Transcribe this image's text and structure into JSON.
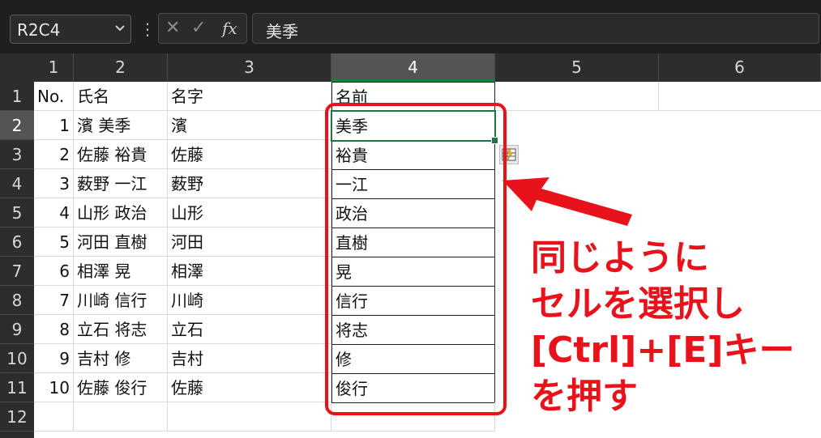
{
  "formula_bar": {
    "name_box": "R2C4",
    "dropdown_icon": "chevron-down-icon",
    "separator": "⋮",
    "cancel_icon": "✕",
    "enter_icon": "✓",
    "fx_label": "fx",
    "value": "美季"
  },
  "columns": [
    "1",
    "2",
    "3",
    "4",
    "5",
    "6"
  ],
  "rows": [
    "1",
    "2",
    "3",
    "4",
    "5",
    "6",
    "7",
    "8",
    "9",
    "10",
    "11",
    "12"
  ],
  "sheet": {
    "headers": [
      "No.",
      "氏名",
      "名字",
      "名前"
    ],
    "data": [
      [
        "1",
        "濱 美季",
        "濱",
        "美季"
      ],
      [
        "2",
        "佐藤 裕貴",
        "佐藤",
        "裕貴"
      ],
      [
        "3",
        "薮野 一江",
        "薮野",
        "一江"
      ],
      [
        "4",
        "山形 政治",
        "山形",
        "政治"
      ],
      [
        "5",
        "河田 直樹",
        "河田",
        "直樹"
      ],
      [
        "6",
        "相澤 晃",
        "相澤",
        "晃"
      ],
      [
        "7",
        "川崎 信行",
        "川崎",
        "信行"
      ],
      [
        "8",
        "立石 将志",
        "立石",
        "将志"
      ],
      [
        "9",
        "吉村 修",
        "吉村",
        "修"
      ],
      [
        "10",
        "佐藤 俊行",
        "佐藤",
        "俊行"
      ]
    ]
  },
  "selection": {
    "active_cell": "R2C4",
    "selected_column": "4",
    "selected_row": "2"
  },
  "annotation": {
    "lines": [
      "同じように",
      "セルを選択し",
      "[Ctrl]+[E]キー",
      "を押す"
    ],
    "color": "#e8131a"
  },
  "colors": {
    "accent_green": "#217346",
    "header_bg": "#2d2d2d",
    "annotation_red": "#e8131a"
  }
}
